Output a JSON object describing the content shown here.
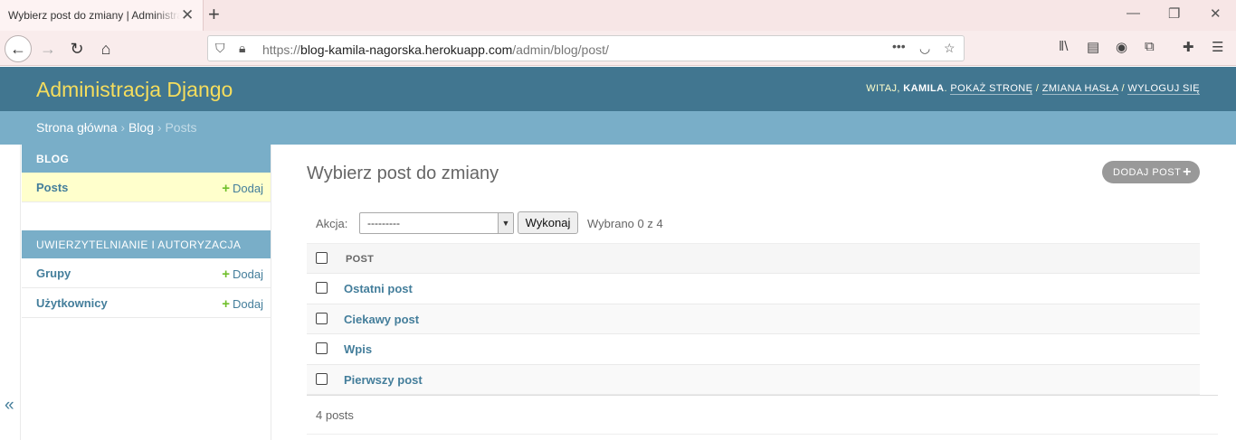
{
  "browser": {
    "tab_title": "Wybierz post do zmiany | Administracja Django",
    "url_prefix": "https://",
    "url_host": "blog-kamila-nagorska.herokuapp.com",
    "url_path": "/admin/blog/post/"
  },
  "header": {
    "branding": "Administracja Django",
    "welcome": "Witaj, ",
    "username": "Kamila",
    "view_site": "Pokaż stronę",
    "change_password": "Zmiana hasła",
    "logout": "Wyloguj się",
    "sep": " / "
  },
  "breadcrumbs": {
    "home": "Strona główna",
    "app": "Blog",
    "current": "Posts",
    "sep": "›"
  },
  "sidebar": {
    "modules": [
      {
        "caption": "Blog",
        "items": [
          {
            "name": "Posts",
            "add": "Dodaj"
          }
        ]
      },
      {
        "caption": "Uwierzytelnianie i autoryzacja",
        "items": [
          {
            "name": "Grupy",
            "add": "Dodaj"
          },
          {
            "name": "Użytkownicy",
            "add": "Dodaj"
          }
        ]
      }
    ],
    "toggle": "«"
  },
  "content": {
    "title": "Wybierz post do zmiany",
    "add_button": "Dodaj post",
    "action_label": "Akcja:",
    "action_selected": "---------",
    "go_button": "Wykonaj",
    "counter": "Wybrano 0 z 4",
    "column": "Post",
    "rows": [
      "Ostatni post",
      "Ciekawy post",
      "Wpis",
      "Pierwszy post"
    ],
    "paginator": "4 posts"
  },
  "colors": {
    "header_bg": "#417690",
    "branding": "#f5dd5d",
    "breadcrumbs_bg": "#79aec8",
    "link": "#447e9b",
    "current_row": "#ffffcc",
    "add_icon": "#70bf2b"
  }
}
